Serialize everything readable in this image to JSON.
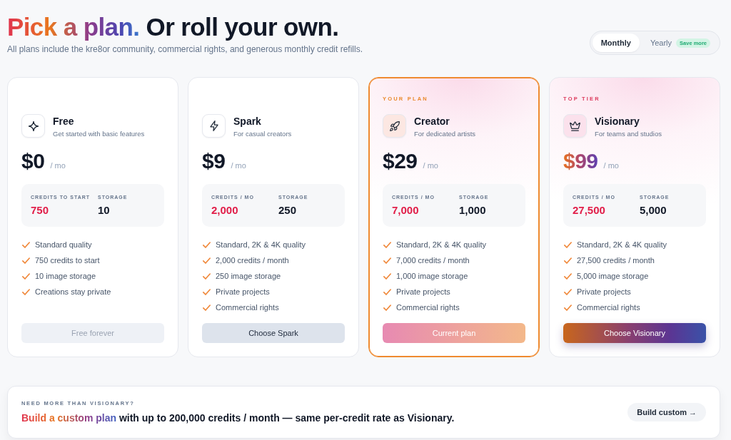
{
  "header": {
    "title_highlight": "Pick a plan.",
    "title_rest": "Or roll your own.",
    "subtitle": "All plans include the kre8or community, commercial rights, and generous monthly credit refills."
  },
  "billing_toggle": [
    {
      "label": "Monthly",
      "selected": true
    },
    {
      "label": "Yearly",
      "selected": false,
      "badge": "Save more"
    }
  ],
  "plans": [
    {
      "kind": "basic",
      "current": false,
      "name": "Free",
      "tagline": "Get started with basic features",
      "price": "$0",
      "period": "/ mo",
      "stats": [
        {
          "kind": "credits",
          "label": "CREDITS TO START",
          "value": "750"
        },
        {
          "kind": "storage",
          "label": "STORAGE",
          "value": "10"
        }
      ],
      "features": [
        "Standard quality",
        "750 credits to start",
        "10 image storage",
        "Creations stay private"
      ],
      "button": {
        "label": "Free forever",
        "disabled": true
      }
    },
    {
      "kind": "basic",
      "current": false,
      "name": "Spark",
      "tagline": "For casual creators",
      "price": "$9",
      "period": "/ mo",
      "stats": [
        {
          "kind": "credits",
          "label": "CREDITS / MO",
          "value": "2,000"
        },
        {
          "kind": "storage",
          "label": "STORAGE",
          "value": "250"
        }
      ],
      "features": [
        "Standard, 2K & 4K quality",
        "2,000 credits / month",
        "250 image storage",
        "Private projects",
        "Commercial rights"
      ],
      "button": {
        "label": "Choose Spark",
        "disabled": false
      }
    },
    {
      "kind": "featured",
      "current": true,
      "eyebrow": "YOUR PLAN",
      "name": "Creator",
      "tagline": "For dedicated artists",
      "price": "$29",
      "period": "/ mo",
      "stats": [
        {
          "kind": "credits",
          "label": "CREDITS / MO",
          "value": "7,000"
        },
        {
          "kind": "storage",
          "label": "STORAGE",
          "value": "1,000"
        }
      ],
      "features": [
        "Standard, 2K & 4K quality",
        "7,000 credits / month",
        "1,000 image storage",
        "Private projects",
        "Commercial rights"
      ],
      "button": {
        "label": "Current plan",
        "disabled": true
      }
    },
    {
      "kind": "premium",
      "current": false,
      "eyebrow": "TOP TIER",
      "name": "Visionary",
      "tagline": "For teams and studios",
      "price": "$99",
      "period": "/ mo",
      "stats": [
        {
          "kind": "credits",
          "label": "CREDITS / MO",
          "value": "27,500"
        },
        {
          "kind": "storage",
          "label": "STORAGE",
          "value": "5,000"
        }
      ],
      "features": [
        "Standard, 2K & 4K quality",
        "27,500 credits / month",
        "5,000 image storage",
        "Private projects",
        "Commercial rights"
      ],
      "button": {
        "label": "Choose Visionary",
        "disabled": false
      }
    }
  ],
  "custom_plan_banner": {
    "eyebrow": "NEED MORE THAN VISIONARY?",
    "headline_highlight": "Build a custom plan",
    "headline_rest": "with up to 200,000 credits / month — same per-credit rate as Visionary.",
    "button": "Build custom →"
  }
}
